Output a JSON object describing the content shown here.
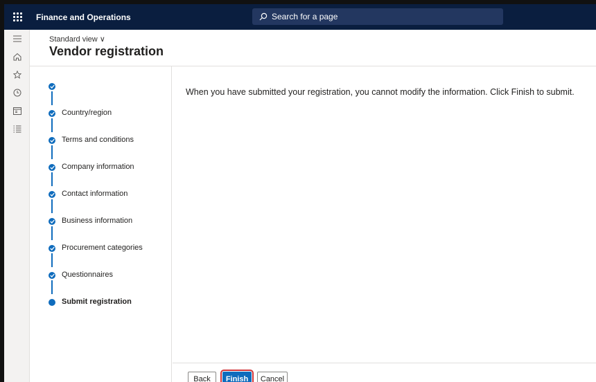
{
  "app": {
    "title": "Finance and Operations"
  },
  "search": {
    "placeholder": "Search for a page"
  },
  "leftnav": {
    "icons": [
      "hamburger-icon",
      "home-icon",
      "star-icon",
      "clock-icon",
      "workspace-icon",
      "list-icon"
    ]
  },
  "header": {
    "view_label": "Standard view ∨",
    "title": "Vendor registration"
  },
  "steps": [
    {
      "label": "",
      "state": "complete"
    },
    {
      "label": "Country/region",
      "state": "complete"
    },
    {
      "label": "Terms and conditions",
      "state": "complete"
    },
    {
      "label": "Company information",
      "state": "complete"
    },
    {
      "label": "Contact information",
      "state": "complete"
    },
    {
      "label": "Business information",
      "state": "complete"
    },
    {
      "label": "Procurement categories",
      "state": "complete"
    },
    {
      "label": "Questionnaires",
      "state": "complete"
    },
    {
      "label": "Submit registration",
      "state": "current"
    }
  ],
  "main": {
    "message": "When you have submitted your registration, you cannot modify the information. Click Finish to submit."
  },
  "footer": {
    "back_label": "Back",
    "finish_label": "Finish",
    "cancel_label": "Cancel"
  },
  "colors": {
    "topbar": "#0a1e3f",
    "accent": "#0f6cbd",
    "highlight": "#d13438"
  }
}
